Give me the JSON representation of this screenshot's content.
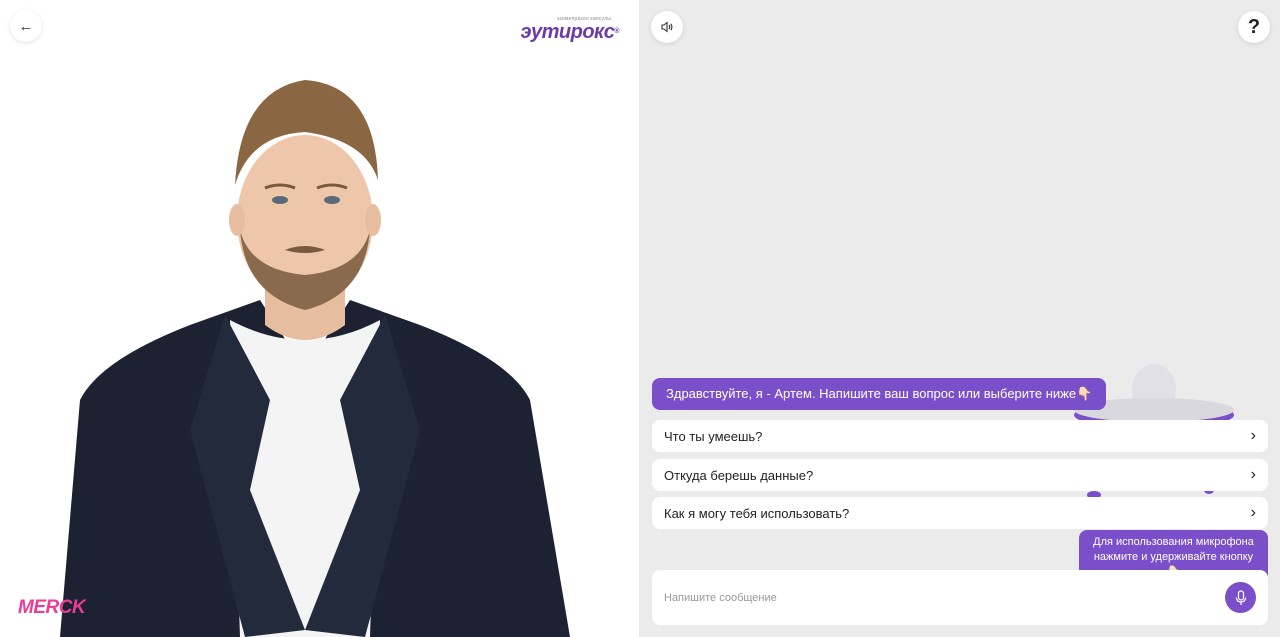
{
  "header": {
    "back_icon": "arrow-left-icon",
    "sound_icon": "speaker-icon",
    "help_label": "?"
  },
  "brand": {
    "small_text": "эзомепразол капсулы",
    "name": "эутирокс",
    "mark": "®"
  },
  "footer_brand": "MERCK",
  "colors": {
    "accent": "#7b4fc9",
    "panel_bg": "#ebebeb",
    "merck_pink": "#eb3c96",
    "brand_purple": "#6c3aa8"
  },
  "chat": {
    "greeting": "Здравствуйте, я - Артем. Напишите ваш вопрос или выберите ниже👇🏻",
    "options": [
      {
        "label": "Что ты умеешь?"
      },
      {
        "label": "Откуда берешь данные?"
      },
      {
        "label": "Как я могу тебя использовать?"
      }
    ],
    "mic_hint_line1": "Для использования микрофона",
    "mic_hint_line2": "нажмите и удерживайте кнопку👇🏻"
  },
  "input": {
    "placeholder": "Напишите сообщение",
    "value": ""
  }
}
